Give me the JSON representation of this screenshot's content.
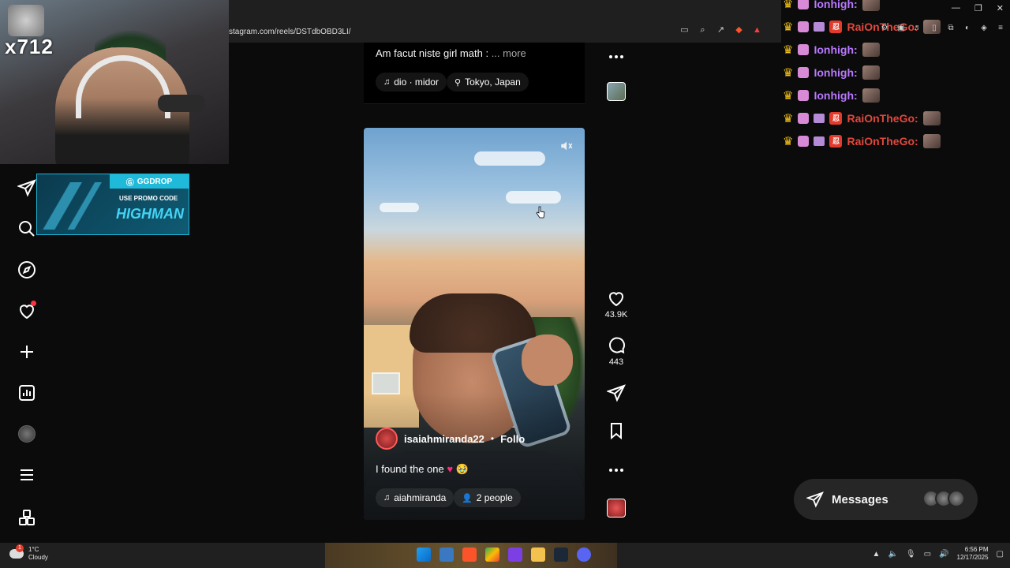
{
  "browser": {
    "url": "stagram.com/reels/DSTdbOBD3LI/"
  },
  "webcam": {
    "overlay_text": "x712"
  },
  "promo": {
    "brand": "GGDROP",
    "line1": "USE PROMO CODE",
    "code": "HIGHMAN"
  },
  "sidebar": {
    "items": [
      {
        "icon": "instagram-logo-icon"
      },
      {
        "icon": "search-icon"
      },
      {
        "icon": "explore-icon"
      },
      {
        "icon": "heart-icon"
      },
      {
        "icon": "create-icon"
      },
      {
        "icon": "dashboard-icon"
      },
      {
        "icon": "profile-icon"
      },
      {
        "icon": "menu-icon"
      },
      {
        "icon": "apps-icon"
      }
    ]
  },
  "prev_post": {
    "caption": "Am facut niste girl math :",
    "more": "... more",
    "audio": "dio · midor",
    "location": "Tokyo, Japan"
  },
  "reel": {
    "username": "isaiahmiranda22",
    "separator": "•",
    "follow": "Follo",
    "caption": "I found the one",
    "caption_emoji": "♥ 🥹",
    "audio": "aiahmiranda",
    "people": "2 people"
  },
  "actions": {
    "likes": "43.9K",
    "comments": "443"
  },
  "chat": [
    {
      "name": "Ionhigh:",
      "color": "#b978ff"
    },
    {
      "name": "RaiOnTheGo:",
      "color": "#e0483d"
    },
    {
      "name": "Ionhigh:",
      "color": "#b978ff"
    },
    {
      "name": "Ionhigh:",
      "color": "#b978ff"
    },
    {
      "name": "Ionhigh:",
      "color": "#b978ff"
    },
    {
      "name": "RaiOnTheGo:",
      "color": "#e0483d"
    },
    {
      "name": "RaiOnTheGo:",
      "color": "#e0483d"
    }
  ],
  "messages": {
    "label": "Messages"
  },
  "taskbar": {
    "weather_temp": "1°C",
    "weather_desc": "Cloudy",
    "weather_badge": "1",
    "time": "6:56 PM",
    "date": "12/17/2025"
  }
}
